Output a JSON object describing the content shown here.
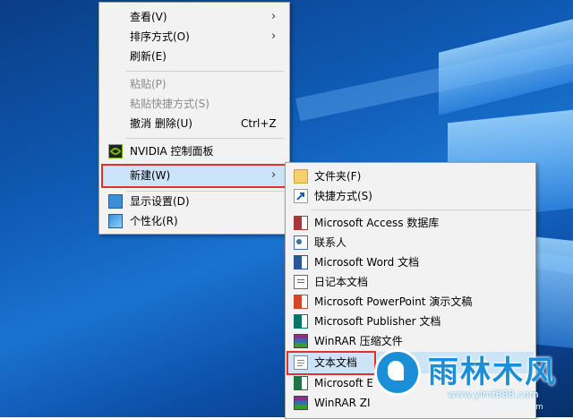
{
  "context_menu": {
    "items": [
      {
        "label": "查看(V)"
      },
      {
        "label": "排序方式(O)"
      },
      {
        "label": "刷新(E)"
      },
      {
        "label": "粘贴(P)"
      },
      {
        "label": "粘贴快捷方式(S)"
      },
      {
        "label": "撤消 删除(U)",
        "shortcut": "Ctrl+Z"
      },
      {
        "label": "NVIDIA 控制面板",
        "icon": "nvidia-icon"
      },
      {
        "label": "新建(W)"
      },
      {
        "label": "显示设置(D)",
        "icon": "display-icon"
      },
      {
        "label": "个性化(R)",
        "icon": "personalize-icon"
      }
    ],
    "arrow": "›"
  },
  "new_submenu": {
    "items": [
      {
        "label": "文件夹(F)",
        "icon": "folder-icon"
      },
      {
        "label": "快捷方式(S)",
        "icon": "shortcut-icon"
      },
      {
        "label": "Microsoft Access 数据库",
        "icon": "access-icon"
      },
      {
        "label": "联系人",
        "icon": "contact-icon"
      },
      {
        "label": "Microsoft Word 文档",
        "icon": "word-icon"
      },
      {
        "label": "日记本文档",
        "icon": "journal-icon"
      },
      {
        "label": "Microsoft PowerPoint 演示文稿",
        "icon": "powerpoint-icon"
      },
      {
        "label": "Microsoft Publisher 文档",
        "icon": "publisher-icon"
      },
      {
        "label": "WinRAR 压缩文件",
        "icon": "winrar-icon"
      },
      {
        "label": "文本文档",
        "icon": "text-document-icon"
      },
      {
        "label": "Microsoft E",
        "icon": "excel-icon"
      },
      {
        "label": "WinRAR ZI",
        "icon": "winrar-zip-icon"
      }
    ]
  },
  "watermark": {
    "title": "雨林木风",
    "url": "www.ylmf888.com",
    "sub": "feifeixitong.com"
  },
  "colors": {
    "highlight_border": "#e03030",
    "menu_bg": "#f2f2f2",
    "desktop": "#0f5bb5"
  }
}
